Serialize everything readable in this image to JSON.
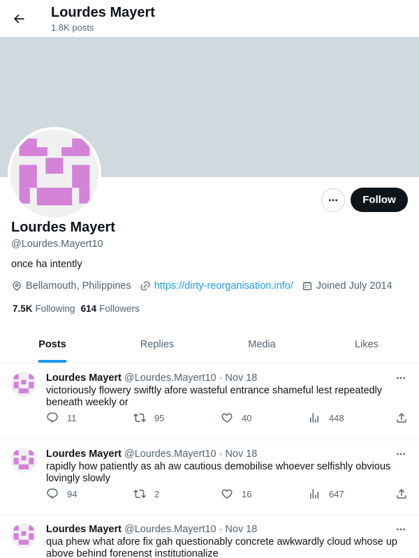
{
  "header": {
    "title": "Lourdes Mayert",
    "posts_count": "1.8K posts"
  },
  "profile": {
    "name": "Lourdes Mayert",
    "handle": "@Lourdes.Mayert10",
    "bio": "once ha intently",
    "location": "Bellamouth, Philippines",
    "website": "https://dirty-reorganisation.info/",
    "joined": "Joined July 2014",
    "following_count": "7.5K",
    "following_label": "Following",
    "followers_count": "614",
    "followers_label": "Followers",
    "follow_label": "Follow"
  },
  "tabs": [
    {
      "label": "Posts"
    },
    {
      "label": "Replies"
    },
    {
      "label": "Media"
    },
    {
      "label": "Likes"
    }
  ],
  "posts": [
    {
      "name": "Lourdes Mayert",
      "handle": "@Lourdes.Mayert10",
      "dot": "·",
      "date": "Nov 18",
      "text": "victoriously flowery swiftly afore wasteful entrance shameful lest repeatedly beneath weekly or",
      "replies": "11",
      "reposts": "95",
      "likes": "40",
      "views": "448"
    },
    {
      "name": "Lourdes Mayert",
      "handle": "@Lourdes.Mayert10",
      "dot": "·",
      "date": "Nov 18",
      "text": "rapidly how patiently as ah aw cautious demobilise whoever selfishly obvious lovingly slowly",
      "replies": "94",
      "reposts": "2",
      "likes": "16",
      "views": "647"
    },
    {
      "name": "Lourdes Mayert",
      "handle": "@Lourdes.Mayert10",
      "dot": "·",
      "date": "Nov 18",
      "text": "qua phew what afore fix gah questionably concrete awkwardly cloud whose up above behind forenenst institutionalize",
      "replies": "",
      "reposts": "",
      "likes": "",
      "views": ""
    }
  ],
  "colors": {
    "accent": "#1d9bf0",
    "banner": "#cfd9de",
    "avatar_pattern": "#d382d8",
    "text": "#0f1419",
    "muted": "#536471"
  },
  "icons": [
    "back-arrow-icon",
    "more-icon",
    "location-icon",
    "link-icon",
    "calendar-icon",
    "reply-icon",
    "repost-icon",
    "like-icon",
    "views-icon",
    "share-icon"
  ]
}
